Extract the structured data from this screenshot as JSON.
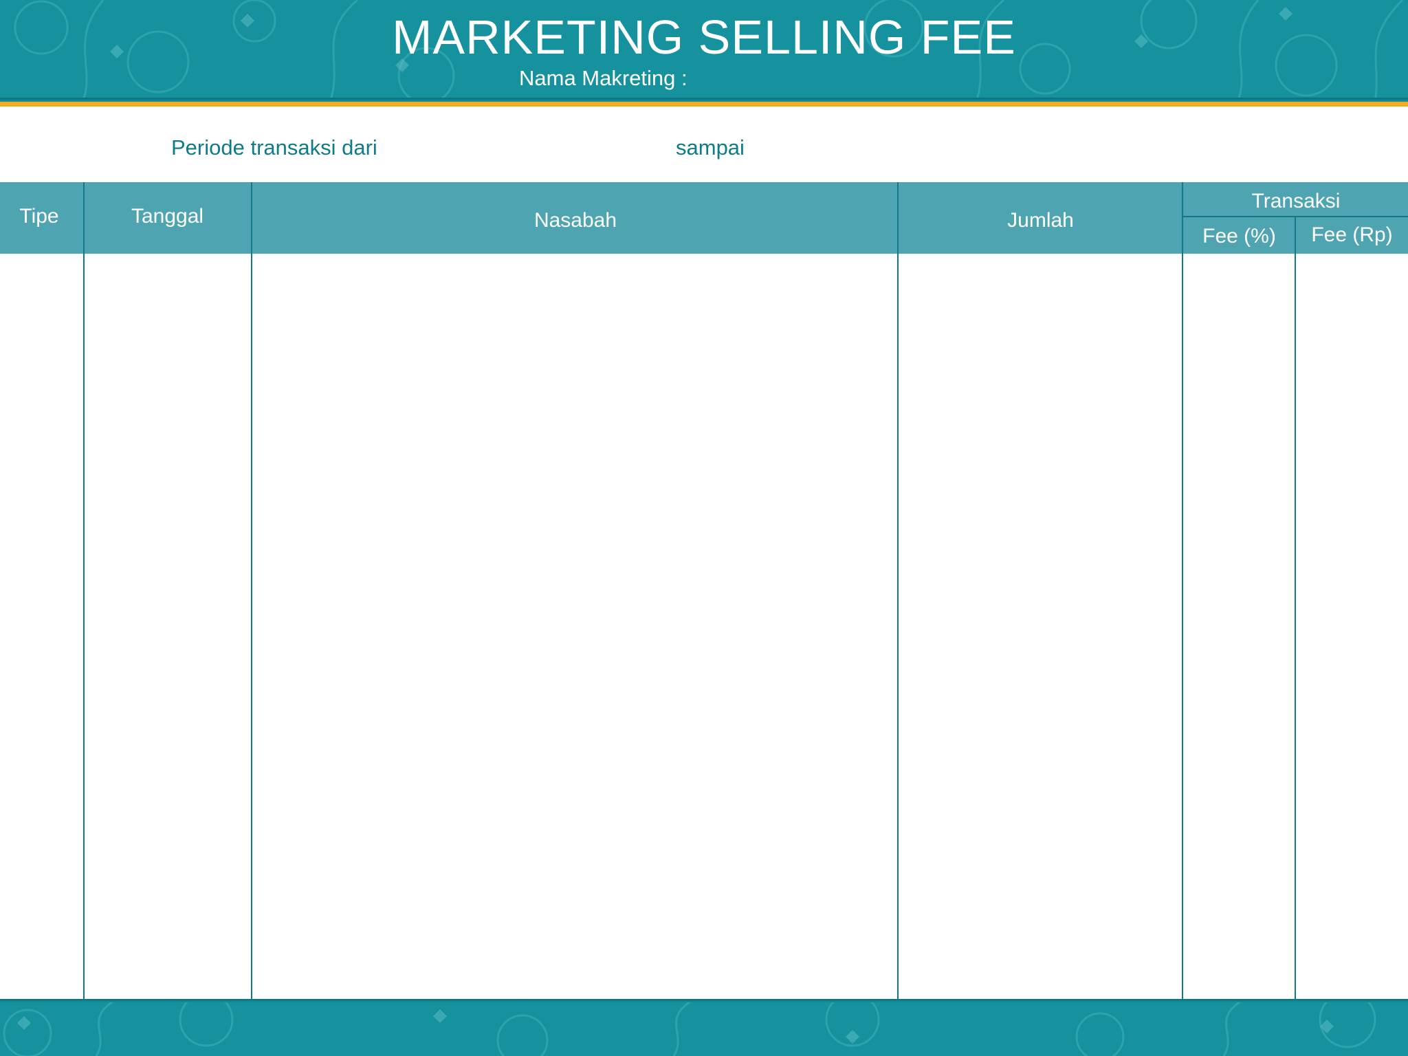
{
  "header": {
    "title": "MARKETING SELLING FEE",
    "subtitle": "Nama Makreting :"
  },
  "period": {
    "from_label": "Periode transaksi dari",
    "to_label": "sampai"
  },
  "table": {
    "columns": {
      "tipe": "Tipe",
      "tanggal": "Tanggal",
      "nasabah": "Nasabah",
      "jumlah": "Jumlah",
      "transaksi": "Transaksi",
      "fee_percent": "Fee (%)",
      "fee_rp": "Fee (Rp)"
    },
    "rows": []
  },
  "colors": {
    "header_bg": "#16929e",
    "accent_stripe": "#f2ad1c",
    "table_header": "#4ea4b1",
    "text_teal": "#0e7c87"
  }
}
